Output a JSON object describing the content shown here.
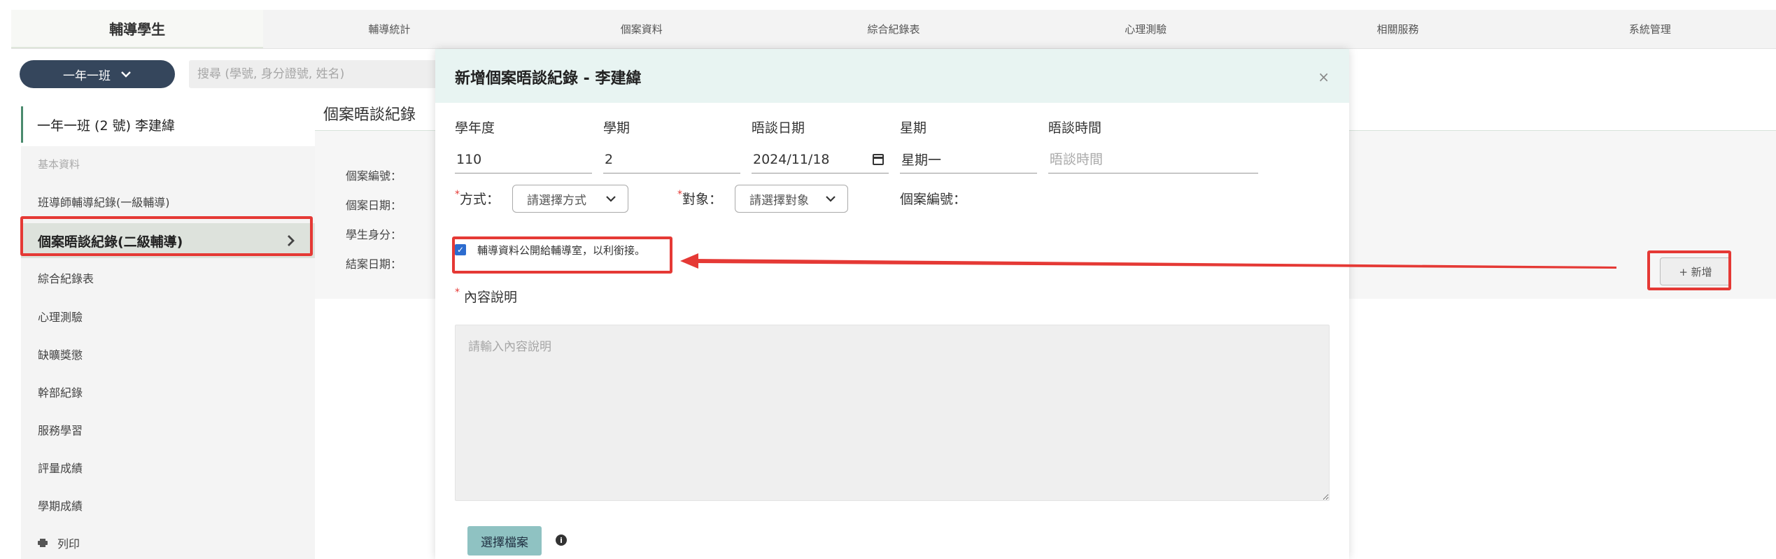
{
  "nav": {
    "tabs": [
      "輔導學生",
      "輔導統計",
      "個案資料",
      "綜合紀錄表",
      "心理測驗",
      "相關服務",
      "系統管理"
    ],
    "active_index": 0
  },
  "class_select": {
    "label": "一年一班",
    "icon": "chevron-down-icon"
  },
  "search": {
    "placeholder": "搜尋 (學號, 身分證號, 姓名)"
  },
  "student": {
    "header": "一年一班 (2 號) 李建緯"
  },
  "sidebar": {
    "items": [
      {
        "label": "基本資料"
      },
      {
        "label": "班導師輔導紀錄(一級輔導)"
      },
      {
        "label": "個案晤談紀錄(二級輔導)"
      },
      {
        "label": "綜合紀錄表"
      },
      {
        "label": "心理測驗"
      },
      {
        "label": "缺曠獎懲"
      },
      {
        "label": "幹部紀錄"
      },
      {
        "label": "服務學習"
      },
      {
        "label": "評量成績"
      },
      {
        "label": "學期成績"
      },
      {
        "label": "列印"
      }
    ],
    "active_index": 2,
    "active_icon": "chevron-right-icon",
    "print_icon": "printer-icon"
  },
  "page": {
    "section_title": "個案晤談紀錄",
    "info_labels": [
      "個案編號：",
      "個案日期：",
      "學生身分：",
      "結案日期："
    ],
    "add_button": "+ 新增"
  },
  "modal": {
    "title": "新增個案晤談紀錄 - 李建緯",
    "close": "×",
    "fields": {
      "year_label": "學年度",
      "year_value": "110",
      "term_label": "學期",
      "term_value": "2",
      "date_label": "晤談日期",
      "date_value": "2024/11/18",
      "weekday_label": "星期",
      "weekday_value": "星期一",
      "time_label": "晤談時間",
      "time_placeholder": "晤談時間"
    },
    "required_mark": "*",
    "method_label": "方式：",
    "method_placeholder": "請選擇方式",
    "target_label": "對象：",
    "target_placeholder": "請選擇對象",
    "case_no_label": "個案編號：",
    "checkbox_label": "輔導資料公開給輔導室，以利銜接。",
    "checkbox_checked": true,
    "content_label": "內容說明",
    "content_placeholder": "請輸入內容說明",
    "file_button": "選擇檔案",
    "info_icon": "info-icon"
  },
  "colors": {
    "accent_dark": "#35465c",
    "modal_header": "#e8f4f2",
    "file_button": "#8fc2c2",
    "highlight": "#e53935",
    "checkbox": "#2d6ccf"
  }
}
